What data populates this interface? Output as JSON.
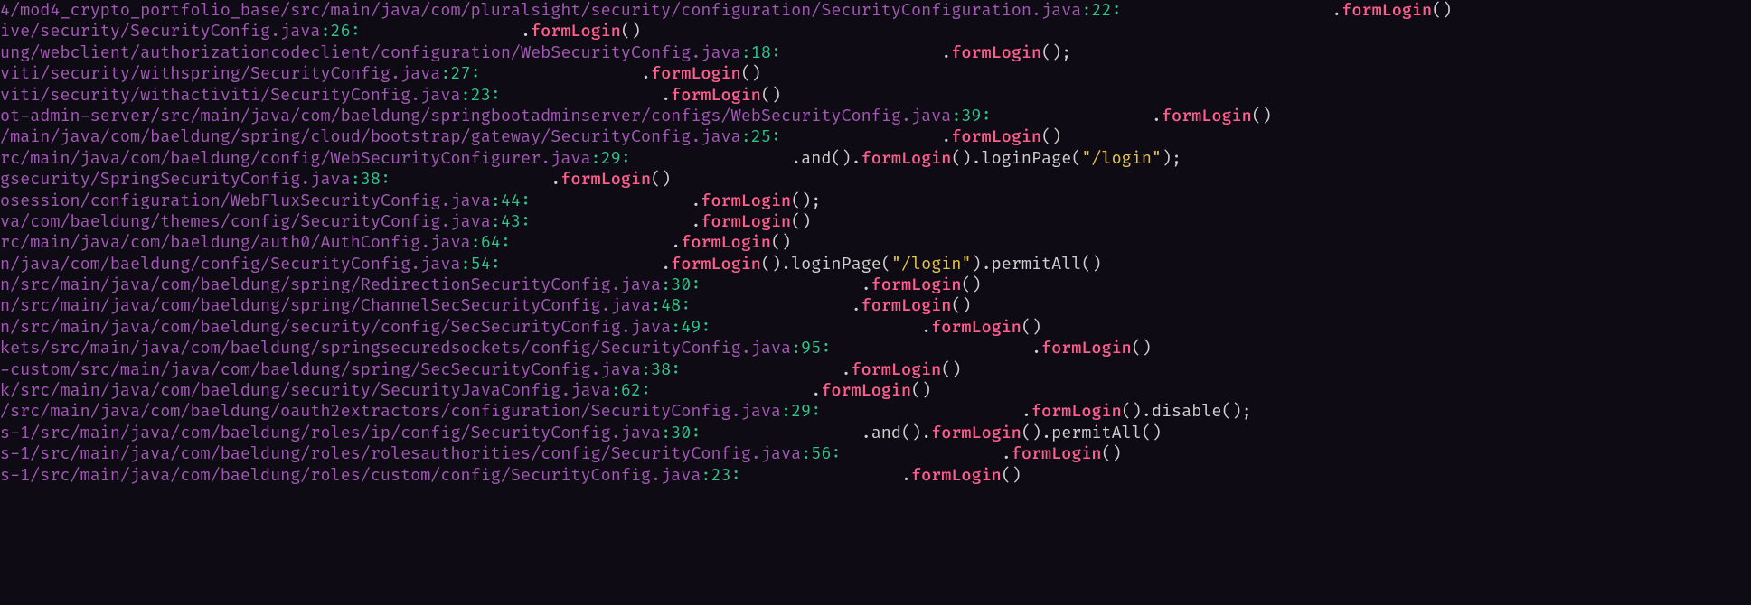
{
  "lines": [
    {
      "path": "4/mod4_crypto_portfolio_base/src/main/java/com/pluralsight/security/configuration/SecurityConfiguration.java",
      "line_no": "22",
      "gap": "                     ",
      "segments": [
        {
          "t": "dot",
          "v": "."
        },
        {
          "t": "fn",
          "v": "formLogin"
        },
        {
          "t": "code",
          "v": "()"
        }
      ]
    },
    {
      "path": "ive/security/SecurityConfig.java",
      "line_no": "26",
      "gap": "                ",
      "segments": [
        {
          "t": "dot",
          "v": "."
        },
        {
          "t": "fn",
          "v": "formLogin"
        },
        {
          "t": "code",
          "v": "()"
        }
      ]
    },
    {
      "path": "ung/webclient/authorizationcodeclient/configuration/WebSecurityConfig.java",
      "line_no": "18",
      "gap": "                ",
      "segments": [
        {
          "t": "dot",
          "v": "."
        },
        {
          "t": "fn",
          "v": "formLogin"
        },
        {
          "t": "code",
          "v": "();"
        }
      ]
    },
    {
      "path": "viti/security/withspring/SecurityConfig.java",
      "line_no": "27",
      "gap": "                ",
      "segments": [
        {
          "t": "dot",
          "v": "."
        },
        {
          "t": "fn",
          "v": "formLogin"
        },
        {
          "t": "code",
          "v": "()"
        }
      ]
    },
    {
      "path": "viti/security/withactiviti/SecurityConfig.java",
      "line_no": "23",
      "gap": "                ",
      "segments": [
        {
          "t": "dot",
          "v": "."
        },
        {
          "t": "fn",
          "v": "formLogin"
        },
        {
          "t": "code",
          "v": "()"
        }
      ]
    },
    {
      "path": "ot-admin-server/src/main/java/com/baeldung/springbootadminserver/configs/WebSecurityConfig.java",
      "line_no": "39",
      "gap": "                ",
      "segments": [
        {
          "t": "dot",
          "v": "."
        },
        {
          "t": "fn",
          "v": "formLogin"
        },
        {
          "t": "code",
          "v": "()"
        }
      ]
    },
    {
      "path": "/main/java/com/baeldung/spring/cloud/bootstrap/gateway/SecurityConfig.java",
      "line_no": "25",
      "gap": "                ",
      "segments": [
        {
          "t": "dot",
          "v": "."
        },
        {
          "t": "fn",
          "v": "formLogin"
        },
        {
          "t": "code",
          "v": "()"
        }
      ]
    },
    {
      "path": "rc/main/java/com/baeldung/config/WebSecurityConfigurer.java",
      "line_no": "29",
      "gap": "                ",
      "segments": [
        {
          "t": "code",
          "v": ".and()."
        },
        {
          "t": "fn",
          "v": "formLogin"
        },
        {
          "t": "code",
          "v": "().loginPage("
        },
        {
          "t": "str",
          "v": "\"/login\""
        },
        {
          "t": "code",
          "v": ");"
        }
      ]
    },
    {
      "path": "gsecurity/SpringSecurityConfig.java",
      "line_no": "38",
      "gap": "                ",
      "segments": [
        {
          "t": "dot",
          "v": "."
        },
        {
          "t": "fn",
          "v": "formLogin"
        },
        {
          "t": "code",
          "v": "()"
        }
      ]
    },
    {
      "path": "osession/configuration/WebFluxSecurityConfig.java",
      "line_no": "44",
      "gap": "                ",
      "segments": [
        {
          "t": "dot",
          "v": "."
        },
        {
          "t": "fn",
          "v": "formLogin"
        },
        {
          "t": "code",
          "v": "();"
        }
      ]
    },
    {
      "path": "va/com/baeldung/themes/config/SecurityConfig.java",
      "line_no": "43",
      "gap": "                ",
      "segments": [
        {
          "t": "dot",
          "v": "."
        },
        {
          "t": "fn",
          "v": "formLogin"
        },
        {
          "t": "code",
          "v": "()"
        }
      ]
    },
    {
      "path": "rc/main/java/com/baeldung/auth0/AuthConfig.java",
      "line_no": "64",
      "gap": "                ",
      "segments": [
        {
          "t": "dot",
          "v": "."
        },
        {
          "t": "fn",
          "v": "formLogin"
        },
        {
          "t": "code",
          "v": "()"
        }
      ]
    },
    {
      "path": "n/java/com/baeldung/config/SecurityConfig.java",
      "line_no": "54",
      "gap": "                ",
      "segments": [
        {
          "t": "dot",
          "v": "."
        },
        {
          "t": "fn",
          "v": "formLogin"
        },
        {
          "t": "code",
          "v": "().loginPage("
        },
        {
          "t": "str",
          "v": "\"/login\""
        },
        {
          "t": "code",
          "v": ").permitAll()"
        }
      ]
    },
    {
      "path": "n/src/main/java/com/baeldung/spring/RedirectionSecurityConfig.java",
      "line_no": "30",
      "gap": "                ",
      "segments": [
        {
          "t": "dot",
          "v": "."
        },
        {
          "t": "fn",
          "v": "formLogin"
        },
        {
          "t": "code",
          "v": "()"
        }
      ]
    },
    {
      "path": "n/src/main/java/com/baeldung/spring/ChannelSecSecurityConfig.java",
      "line_no": "48",
      "gap": "                ",
      "segments": [
        {
          "t": "dot",
          "v": "."
        },
        {
          "t": "fn",
          "v": "formLogin"
        },
        {
          "t": "code",
          "v": "()"
        }
      ]
    },
    {
      "path": "n/src/main/java/com/baeldung/security/config/SecSecurityConfig.java",
      "line_no": "49",
      "gap": "                     ",
      "segments": [
        {
          "t": "dot",
          "v": "."
        },
        {
          "t": "fn",
          "v": "formLogin"
        },
        {
          "t": "code",
          "v": "()"
        }
      ]
    },
    {
      "path": "kets/src/main/java/com/baeldung/springsecuredsockets/config/SecurityConfig.java",
      "line_no": "95",
      "gap": "                    ",
      "segments": [
        {
          "t": "dot",
          "v": "."
        },
        {
          "t": "fn",
          "v": "formLogin"
        },
        {
          "t": "code",
          "v": "()"
        }
      ]
    },
    {
      "path": "-custom/src/main/java/com/baeldung/spring/SecSecurityConfig.java",
      "line_no": "38",
      "gap": "                ",
      "segments": [
        {
          "t": "dot",
          "v": "."
        },
        {
          "t": "fn",
          "v": "formLogin"
        },
        {
          "t": "code",
          "v": "()"
        }
      ]
    },
    {
      "path": "k/src/main/java/com/baeldung/security/SecurityJavaConfig.java",
      "line_no": "62",
      "gap": "                ",
      "segments": [
        {
          "t": "dot",
          "v": "."
        },
        {
          "t": "fn",
          "v": "formLogin"
        },
        {
          "t": "code",
          "v": "()"
        }
      ]
    },
    {
      "path": "/src/main/java/com/baeldung/oauth2extractors/configuration/SecurityConfig.java",
      "line_no": "29",
      "gap": "                    ",
      "segments": [
        {
          "t": "dot",
          "v": "."
        },
        {
          "t": "fn",
          "v": "formLogin"
        },
        {
          "t": "code",
          "v": "().disable();"
        }
      ]
    },
    {
      "path": "s-1/src/main/java/com/baeldung/roles/ip/config/SecurityConfig.java",
      "line_no": "30",
      "gap": "                ",
      "segments": [
        {
          "t": "code",
          "v": ".and()."
        },
        {
          "t": "fn",
          "v": "formLogin"
        },
        {
          "t": "code",
          "v": "().permitAll()"
        }
      ]
    },
    {
      "path": "s-1/src/main/java/com/baeldung/roles/rolesauthorities/config/SecurityConfig.java",
      "line_no": "56",
      "gap": "                ",
      "segments": [
        {
          "t": "dot",
          "v": "."
        },
        {
          "t": "fn",
          "v": "formLogin"
        },
        {
          "t": "code",
          "v": "()"
        }
      ]
    },
    {
      "path": "s-1/src/main/java/com/baeldung/roles/custom/config/SecurityConfig.java",
      "line_no": "23",
      "gap": "                ",
      "segments": [
        {
          "t": "dot",
          "v": "."
        },
        {
          "t": "fn",
          "v": "formLogin"
        },
        {
          "t": "code",
          "v": "()"
        }
      ]
    }
  ]
}
